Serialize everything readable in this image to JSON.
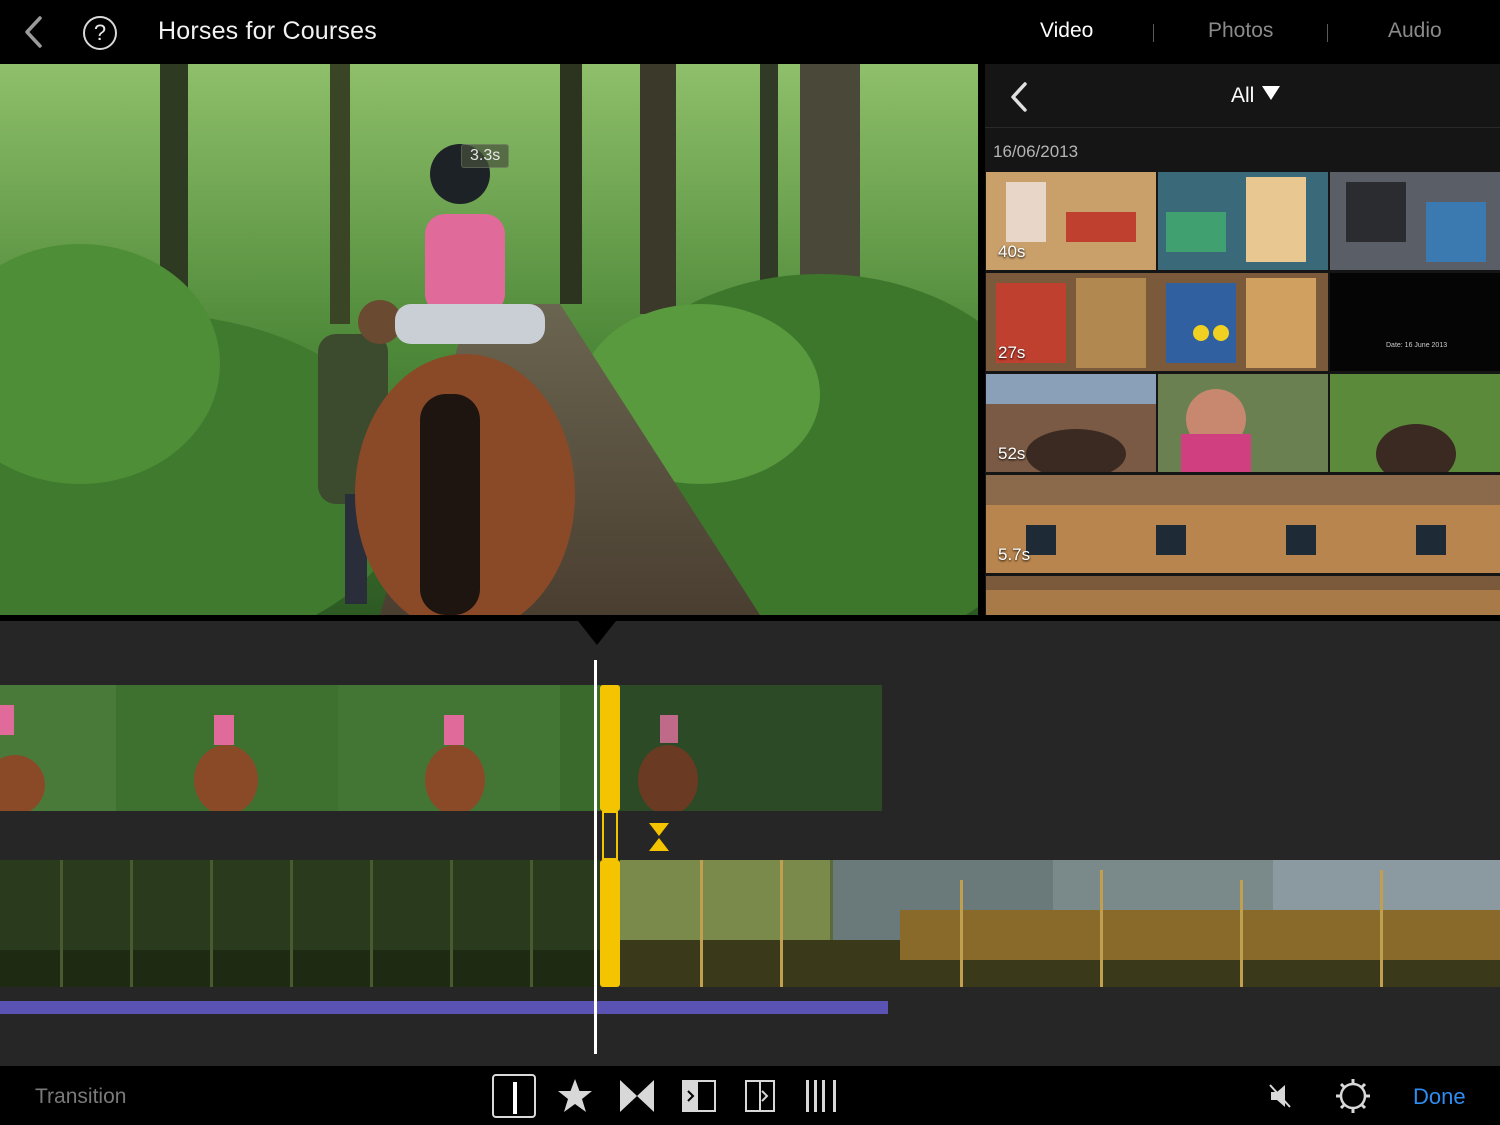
{
  "header": {
    "back_icon": "chevron-left-icon",
    "help_glyph": "?",
    "project_title": "Horses for Courses",
    "tabs": [
      {
        "label": "Video",
        "active": true
      },
      {
        "label": "Photos",
        "active": false
      },
      {
        "label": "Audio",
        "active": false
      }
    ]
  },
  "viewer": {
    "clip_duration": "3.3s"
  },
  "browser": {
    "filter_label": "All",
    "date": "16/06/2013",
    "clips": [
      {
        "duration": "40s"
      },
      {
        "duration": "27s",
        "title_card": "Date: 16 June 2013"
      },
      {
        "duration": "52s"
      },
      {
        "duration": "5.7s"
      }
    ]
  },
  "toolbar": {
    "mode_label": "Transition",
    "tools": [
      "cut-icon",
      "star-icon",
      "cross-dissolve-icon",
      "slide-left-icon",
      "slide-right-icon",
      "wipe-icon"
    ],
    "done_label": "Done"
  },
  "colors": {
    "accent": "#2f8cf0",
    "trim_handle": "#f5c400",
    "audio_track": "#5a53b4"
  }
}
